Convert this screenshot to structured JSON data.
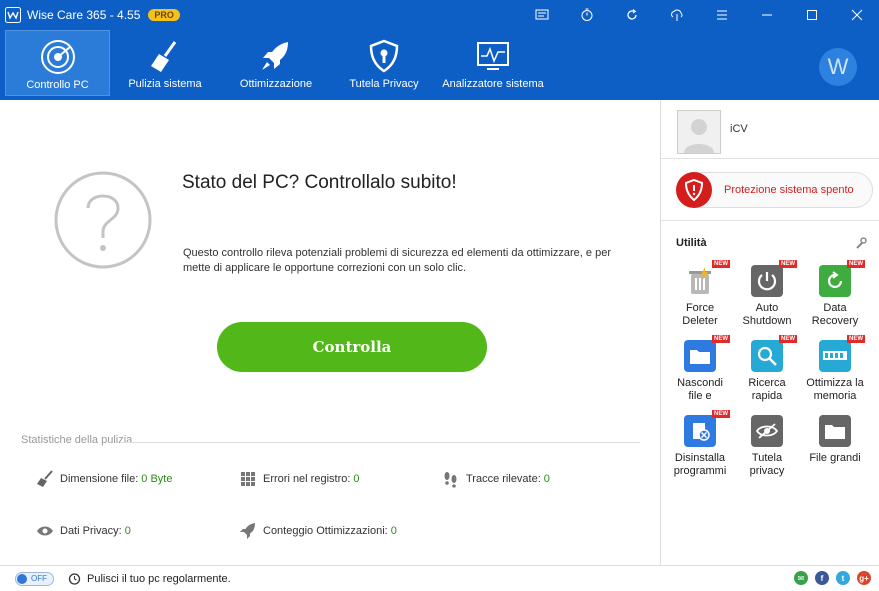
{
  "window": {
    "title": "Wise Care 365 - 4.55",
    "badge": "PRO",
    "controls": [
      "feedback-icon",
      "timer-icon",
      "refresh-icon",
      "cloud-icon",
      "menu-icon",
      "minimize-icon",
      "maximize-icon",
      "close-icon"
    ]
  },
  "nav": {
    "items": [
      {
        "label": "Controllo PC",
        "icon": "radar-icon",
        "active": true
      },
      {
        "label": "Pulizia sistema",
        "icon": "broom-icon",
        "active": false
      },
      {
        "label": "Ottimizzazione",
        "icon": "rocket-icon",
        "active": false
      },
      {
        "label": "Tutela Privacy",
        "icon": "shield-icon",
        "active": false
      },
      {
        "label": "Analizzatore sistema",
        "icon": "monitor-icon",
        "active": false
      }
    ],
    "account_initial": "W"
  },
  "main": {
    "title": "Stato del PC? Controllalo subito!",
    "description": "Questo controllo rileva potenziali problemi di sicurezza ed elementi da ottimizzare, e per mette di applicare le opportune correzioni con un solo clic.",
    "check_button": "Controlla",
    "stats_title": "Statistiche della pulizia",
    "stats": [
      {
        "label": "Dimensione file:",
        "value": "0 Byte",
        "icon": "broom-icon"
      },
      {
        "label": "Errori nel registro:",
        "value": "0",
        "icon": "grid-icon"
      },
      {
        "label": "Tracce rilevate:",
        "value": "0",
        "icon": "footprints-icon"
      },
      {
        "label": "Dati Privacy:",
        "value": "0",
        "icon": "eye-icon"
      },
      {
        "label": "Conteggio Ottimizzazioni:",
        "value": "0",
        "icon": "rocket-icon"
      }
    ]
  },
  "side": {
    "username": "iCV",
    "protection_label": "Protezione sistema spento",
    "utilities_title": "Utilità",
    "new_badge": "NEW",
    "tools": [
      {
        "label1": "Force",
        "label2": "Deleter",
        "icon": "trash-icon",
        "new": true
      },
      {
        "label1": "Auto",
        "label2": "Shutdown",
        "icon": "power-icon",
        "new": true
      },
      {
        "label1": "Data",
        "label2": "Recovery",
        "icon": "recovery-icon",
        "new": true
      },
      {
        "label1": "Nascondi",
        "label2": "file e",
        "icon": "folder-icon",
        "new": true
      },
      {
        "label1": "Ricerca",
        "label2": "rapida",
        "icon": "search-icon",
        "new": true
      },
      {
        "label1": "Ottimizza la",
        "label2": "memoria",
        "icon": "memory-icon",
        "new": true
      },
      {
        "label1": "Disinstalla",
        "label2": "programmi",
        "icon": "uninstall-icon",
        "new": true
      },
      {
        "label1": "Tutela",
        "label2": "privacy",
        "icon": "eye-off-icon",
        "new": false
      },
      {
        "label1": "File grandi",
        "label2": "",
        "icon": "big-folder-icon",
        "new": false
      }
    ]
  },
  "status": {
    "toggle_label": "OFF",
    "text": "Pulisci il tuo pc regolarmente.",
    "social": [
      {
        "icon": "email-icon",
        "color": "#3aa04a",
        "glyph": "✉"
      },
      {
        "icon": "facebook-icon",
        "color": "#3b5998",
        "glyph": "f"
      },
      {
        "icon": "twitter-icon",
        "color": "#33a7e0",
        "glyph": "t"
      },
      {
        "icon": "googleplus-icon",
        "color": "#d9472b",
        "glyph": "g+"
      }
    ]
  }
}
